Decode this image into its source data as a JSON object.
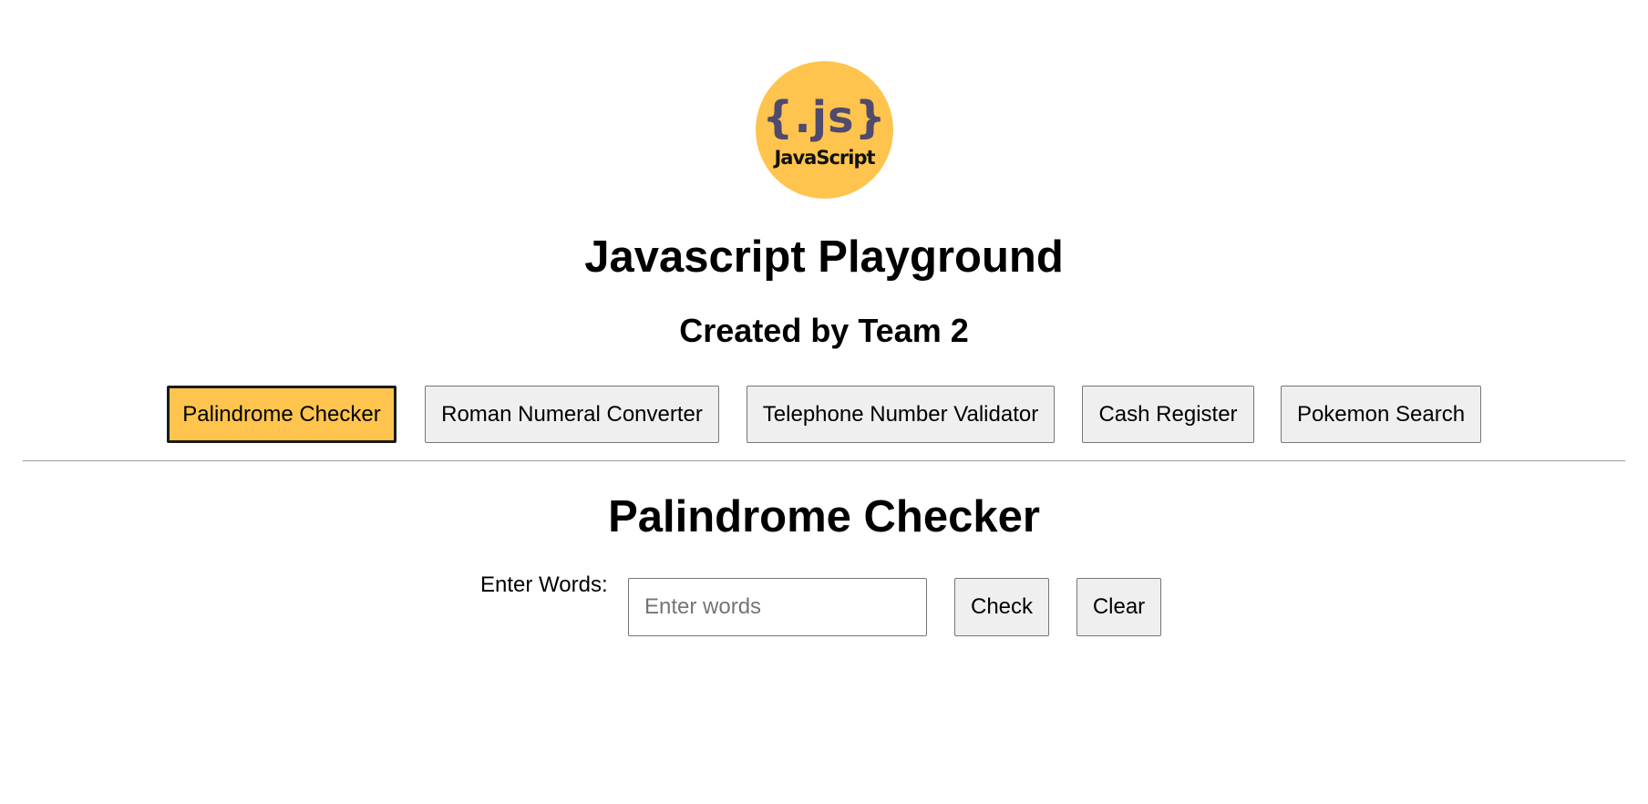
{
  "logo": {
    "mark": "{.js}",
    "text": "JavaScript",
    "color": "#ffc44d",
    "mark_color": "#4f4a6e"
  },
  "header": {
    "title": "Javascript Playground",
    "subtitle": "Created by Team 2"
  },
  "nav": {
    "items": [
      {
        "label": "Palindrome Checker",
        "active": true
      },
      {
        "label": "Roman Numeral Converter",
        "active": false
      },
      {
        "label": "Telephone Number Validator",
        "active": false
      },
      {
        "label": "Cash Register",
        "active": false
      },
      {
        "label": "Pokemon Search",
        "active": false
      }
    ],
    "active_color": "#ffc44d"
  },
  "main": {
    "section_title": "Palindrome Checker",
    "form": {
      "label": "Enter Words:",
      "input_value": "",
      "input_placeholder": "Enter words",
      "check_label": "Check",
      "clear_label": "Clear"
    }
  }
}
